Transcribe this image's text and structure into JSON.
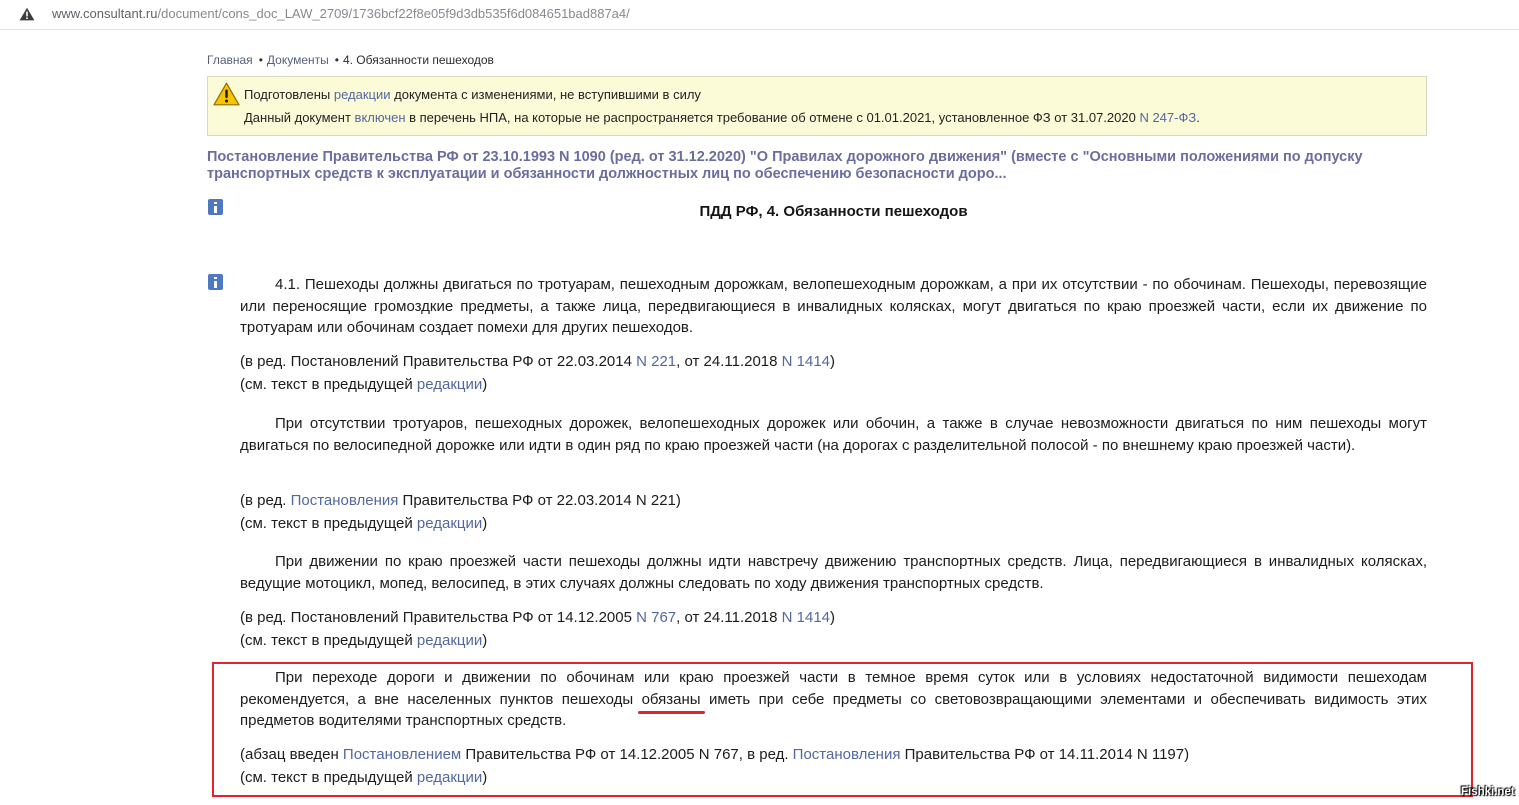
{
  "browser": {
    "security_icon": "warning-triangle-icon",
    "url_domain": "www.consultant.ru",
    "url_path": "/document/cons_doc_LAW_2709/1736bcf22f8e05f9d3db535f6d084651bad887a4/"
  },
  "breadcrumb": {
    "separator": "•",
    "items": [
      "Главная",
      "Документы",
      "4. Обязанности пешеходов"
    ]
  },
  "notice": {
    "icon": "warning-icon",
    "line1": {
      "before": "Подготовлены ",
      "link": "редакции",
      "after": " документа с изменениями, не вступившими в силу"
    },
    "line2": {
      "before": "Данный документ ",
      "link_included": "включен",
      "middle": " в перечень НПА, на которые не распространяется требование об отмене с 01.01.2021, установленное ФЗ от 31.07.2020 ",
      "link_law": "N 247-ФЗ",
      "after": "."
    }
  },
  "document": {
    "title": "Постановление Правительства РФ от 23.10.1993 N 1090 (ред. от 31.12.2020) \"О Правилах дорожного движения\" (вместе с \"Основными положениями по допуску транспортных средств к эксплуатации и обязанности должностных лиц по обеспечению безопасности доро...",
    "info_icon": "info-icon",
    "heading": "ПДД РФ, 4. Обязанности пешеходов",
    "sections": [
      {
        "paragraph": "4.1. Пешеходы должны двигаться по тротуарам, пешеходным дорожкам, велопешеходным дорожкам, а при их отсутствии - по обочинам. Пешеходы, перевозящие или переносящие громоздкие предметы, а также лица, передвигающиеся в инвалидных колясках, могут двигаться по краю проезжей части, если их движение по тротуарам или обочинам создает помехи для других пешеходов.",
        "amendment": {
          "t1": "(в ред. Постановлений Правительства РФ от 22.03.2014 ",
          "l1": "N 221",
          "t2": ", от 24.11.2018 ",
          "l2": "N 1414",
          "t3": ")"
        },
        "previous": {
          "t1": "(см. текст в предыдущей ",
          "l1": "редакции",
          "t2": ")"
        }
      },
      {
        "paragraph": "При отсутствии тротуаров, пешеходных дорожек, велопешеходных дорожек или обочин, а также в случае невозможности двигаться по ним пешеходы могут двигаться по велосипедной дорожке или идти в один ряд по краю проезжей части (на дорогах с разделительной полосой - по внешнему краю проезжей части).",
        "amendment": {
          "t1": "(в ред. ",
          "l1": "Постановления",
          "t2": " Правительства РФ от 22.03.2014 N 221)"
        },
        "previous": {
          "t1": "(см. текст в предыдущей ",
          "l1": "редакции",
          "t2": ")"
        }
      },
      {
        "paragraph": "При движении по краю проезжей части пешеходы должны идти навстречу движению транспортных средств. Лица, передвигающиеся в инвалидных колясках, ведущие мотоцикл, мопед, велосипед, в этих случаях должны следовать по ходу движения транспортных средств.",
        "amendment": {
          "t1": "(в ред. Постановлений Правительства РФ от 14.12.2005 ",
          "l1": "N 767",
          "t2": ", от 24.11.2018 ",
          "l2": "N 1414",
          "t3": ")"
        },
        "previous": {
          "t1": "(см. текст в предыдущей ",
          "l1": "редакции",
          "t2": ")"
        }
      },
      {
        "paragraph_before": "При переходе дороги и движении по обочинам или краю проезжей части в темное время суток или в условиях недостаточной видимости пешеходам рекомендуется, а вне населенных пунктов пешеходы ",
        "highlighted_word": "обязаны",
        "paragraph_after": " иметь при себе предметы со световозвращающими элементами и обеспечивать видимость этих предметов водителями транспортных средств.",
        "amendment": {
          "t1": "(абзац введен ",
          "l1": "Постановлением",
          "t2": " Правительства РФ от 14.12.2005 N 767, в ред. ",
          "l2": "Постановления",
          "t3": " Правительства РФ от 14.11.2014 N 1197)"
        },
        "previous": {
          "t1": "(см. текст в предыдущей ",
          "l1": "редакции",
          "t2": ")"
        }
      }
    ]
  },
  "watermark": "Fishki.net",
  "colors": {
    "link": "#52689f",
    "title": "#6a6d9d",
    "highlight_box": "#e3232b",
    "notice_background": "#fcfbd7",
    "info_icon": "#4f78c2"
  }
}
